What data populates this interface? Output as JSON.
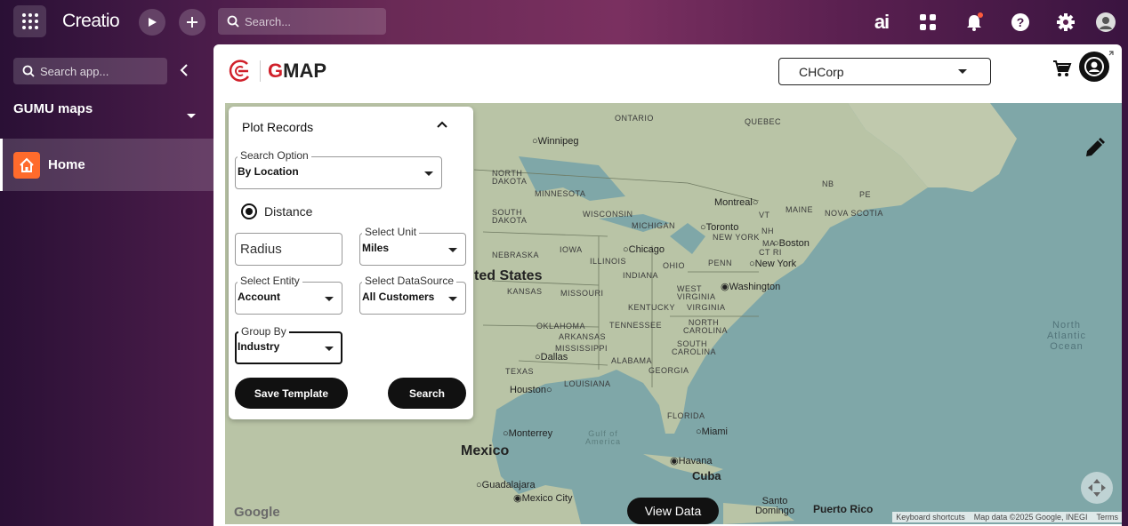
{
  "topbar": {
    "brand": "Creatio",
    "search_placeholder": "Search...",
    "ai_label": "ai"
  },
  "sidebar": {
    "search_placeholder": "Search app...",
    "section_title": "GUMU maps",
    "items": [
      {
        "label": "Home",
        "active": true
      }
    ]
  },
  "header": {
    "logo_text_accent": "G",
    "logo_text_rest": "MAP",
    "org_select": "CHCorp"
  },
  "panel": {
    "title": "Plot Records",
    "search_option": {
      "label": "Search Option",
      "value": "By Location"
    },
    "distance_label": "Distance",
    "radius_placeholder": "Radius",
    "unit": {
      "label": "Select Unit",
      "value": "Miles"
    },
    "entity": {
      "label": "Select Entity",
      "value": "Account"
    },
    "datasource": {
      "label": "Select DataSource",
      "value": "All Customers"
    },
    "group_by": {
      "label": "Group By",
      "value": "Industry"
    },
    "save_template_label": "Save Template",
    "search_label": "Search"
  },
  "map": {
    "view_data_label": "View Data",
    "google_label": "Google",
    "attribution": [
      "Keyboard shortcuts",
      "Map data ©2025 Google, INEGI",
      "Terms"
    ],
    "regions": [
      {
        "t": "ONTARIO"
      },
      {
        "t": "QUEBEC"
      },
      {
        "t": "NORTH DAKOTA"
      },
      {
        "t": "MINNESOTA"
      },
      {
        "t": "SOUTH DAKOTA"
      },
      {
        "t": "WISCONSIN"
      },
      {
        "t": "MICHIGAN"
      },
      {
        "t": "NEBRASKA"
      },
      {
        "t": "IOWA"
      },
      {
        "t": "ILLINOIS"
      },
      {
        "t": "INDIANA"
      },
      {
        "t": "OHIO"
      },
      {
        "t": "PENN"
      },
      {
        "t": "KANSAS"
      },
      {
        "t": "MISSOURI"
      },
      {
        "t": "KENTUCKY"
      },
      {
        "t": "WEST VIRGINIA"
      },
      {
        "t": "VIRGINIA"
      },
      {
        "t": "OKLAHOMA"
      },
      {
        "t": "ARKANSAS"
      },
      {
        "t": "TENNESSEE"
      },
      {
        "t": "NORTH CAROLINA"
      },
      {
        "t": "SOUTH CAROLINA"
      },
      {
        "t": "MISSISSIPPI"
      },
      {
        "t": "ALABAMA"
      },
      {
        "t": "GEORGIA"
      },
      {
        "t": "TEXAS"
      },
      {
        "t": "LOUISIANA"
      },
      {
        "t": "FLORIDA"
      },
      {
        "t": "NB"
      },
      {
        "t": "PE"
      },
      {
        "t": "NOVA SCOTIA"
      },
      {
        "t": "VT"
      },
      {
        "t": "MAINE"
      },
      {
        "t": "NH"
      },
      {
        "t": "MA"
      },
      {
        "t": "CT RI"
      },
      {
        "t": "NEW YORK"
      }
    ],
    "cities": [
      {
        "t": "Winnipeg"
      },
      {
        "t": "Montreal"
      },
      {
        "t": "Toronto"
      },
      {
        "t": "Boston"
      },
      {
        "t": "Chicago"
      },
      {
        "t": "New York"
      },
      {
        "t": "Washington"
      },
      {
        "t": "Dallas"
      },
      {
        "t": "Houston"
      },
      {
        "t": "Monterrey"
      },
      {
        "t": "Miami"
      },
      {
        "t": "Havana"
      },
      {
        "t": "Guadalajara"
      },
      {
        "t": "Mexico City"
      },
      {
        "t": "Santo Domingo"
      }
    ],
    "big_labels": [
      {
        "t": "ted States"
      },
      {
        "t": "Mexico"
      },
      {
        "t": "Cuba"
      },
      {
        "t": "Puerto Rico"
      }
    ],
    "ocean": [
      {
        "t": "North Atlantic Ocean"
      },
      {
        "t": "Gulf of America"
      }
    ]
  }
}
